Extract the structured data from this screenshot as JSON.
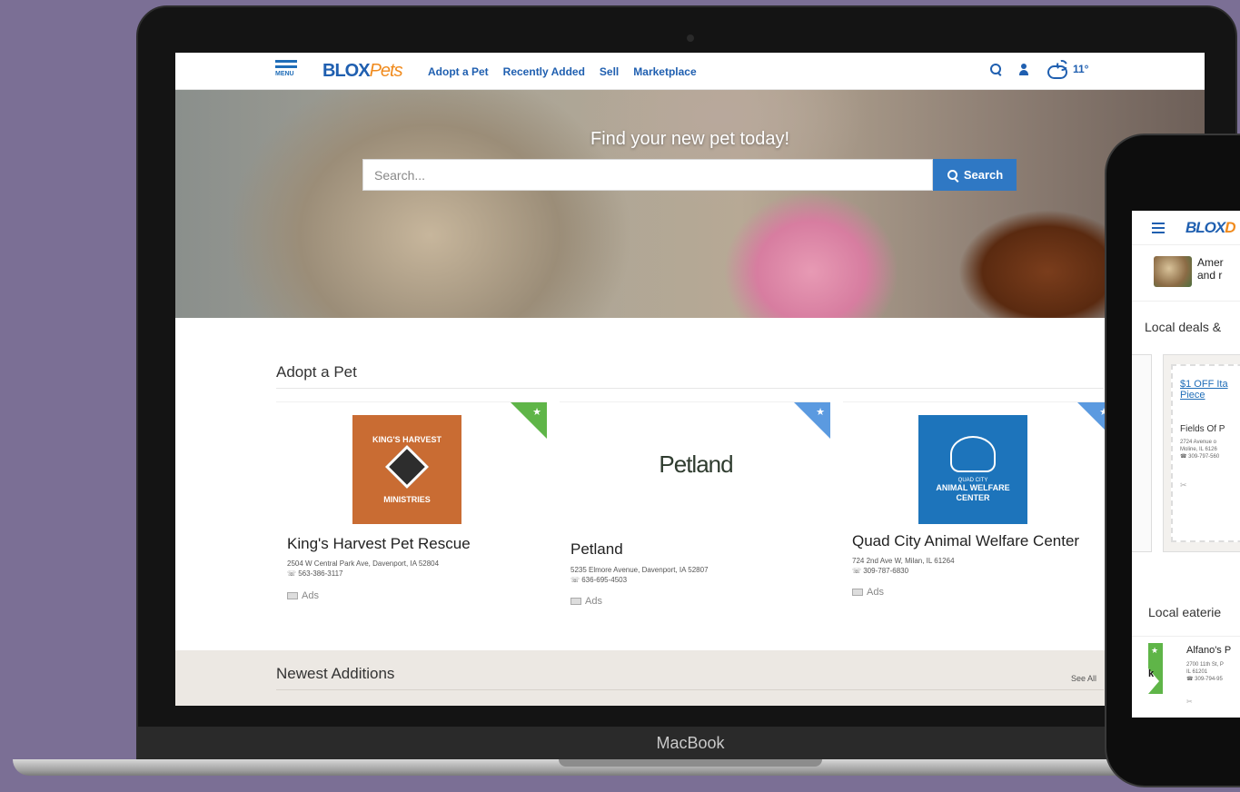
{
  "laptop": {
    "brand": "MacBook"
  },
  "site": {
    "menu_label": "MENU",
    "logo_part1": "BLOX",
    "logo_part2": "Pets",
    "nav_links": [
      "Adopt a Pet",
      "Recently Added",
      "Sell",
      "Marketplace"
    ],
    "weather_temp": "11°",
    "brand_colors": {
      "primary": "#1f5fb0",
      "accent": "#f08a1c",
      "featured_ribbon": "#5fb548",
      "ribbon_blue": "#5b9ae0"
    }
  },
  "hero": {
    "title": "Find your new pet today!",
    "search_placeholder": "Search...",
    "search_button": "Search"
  },
  "adopt_section": {
    "title": "Adopt a Pet",
    "cards": [
      {
        "logo_top": "KING'S HARVEST",
        "logo_bottom": "MINISTRIES",
        "name": "King's Harvest Pet Rescue",
        "address": "2504 W Central Park Ave, Davenport, IA 52804",
        "phone": "563-386-3117",
        "ads": "Ads",
        "ribbon": "green"
      },
      {
        "logo_text": "Petland",
        "name": "Petland",
        "address": "5235 Elmore Avenue, Davenport, IA 52807",
        "phone": "636-695-4503",
        "ads": "Ads",
        "ribbon": "blue"
      },
      {
        "logo_small": "QUAD CITY",
        "logo_big": "ANIMAL WELFARE CENTER",
        "name": "Quad City Animal Welfare Center",
        "address": "724 2nd Ave W, Milan, IL 61264",
        "phone": "309-787-6830",
        "ads": "Ads",
        "ribbon": "blue"
      }
    ]
  },
  "newest": {
    "title": "Newest Additions",
    "see_all": "See All"
  },
  "phone": {
    "logo": "BLOX",
    "logo_cut": "D",
    "ad_text": "Amer\nand r",
    "deals_heading": "Local deals &",
    "coupon_link": "$1 OFF Ita\nPiece",
    "coupon_name": "Fields Of P",
    "coupon_addr": "2724 Avenue o\nMoline, IL 6126\n☎ 309-797-560",
    "scissors": "✂",
    "eateries_heading": "Local eaterie",
    "eatery_name": "Alfano's P",
    "eatery_addr": "2700 11th St, P\nIL 61201\n☎ 309-794-95"
  }
}
